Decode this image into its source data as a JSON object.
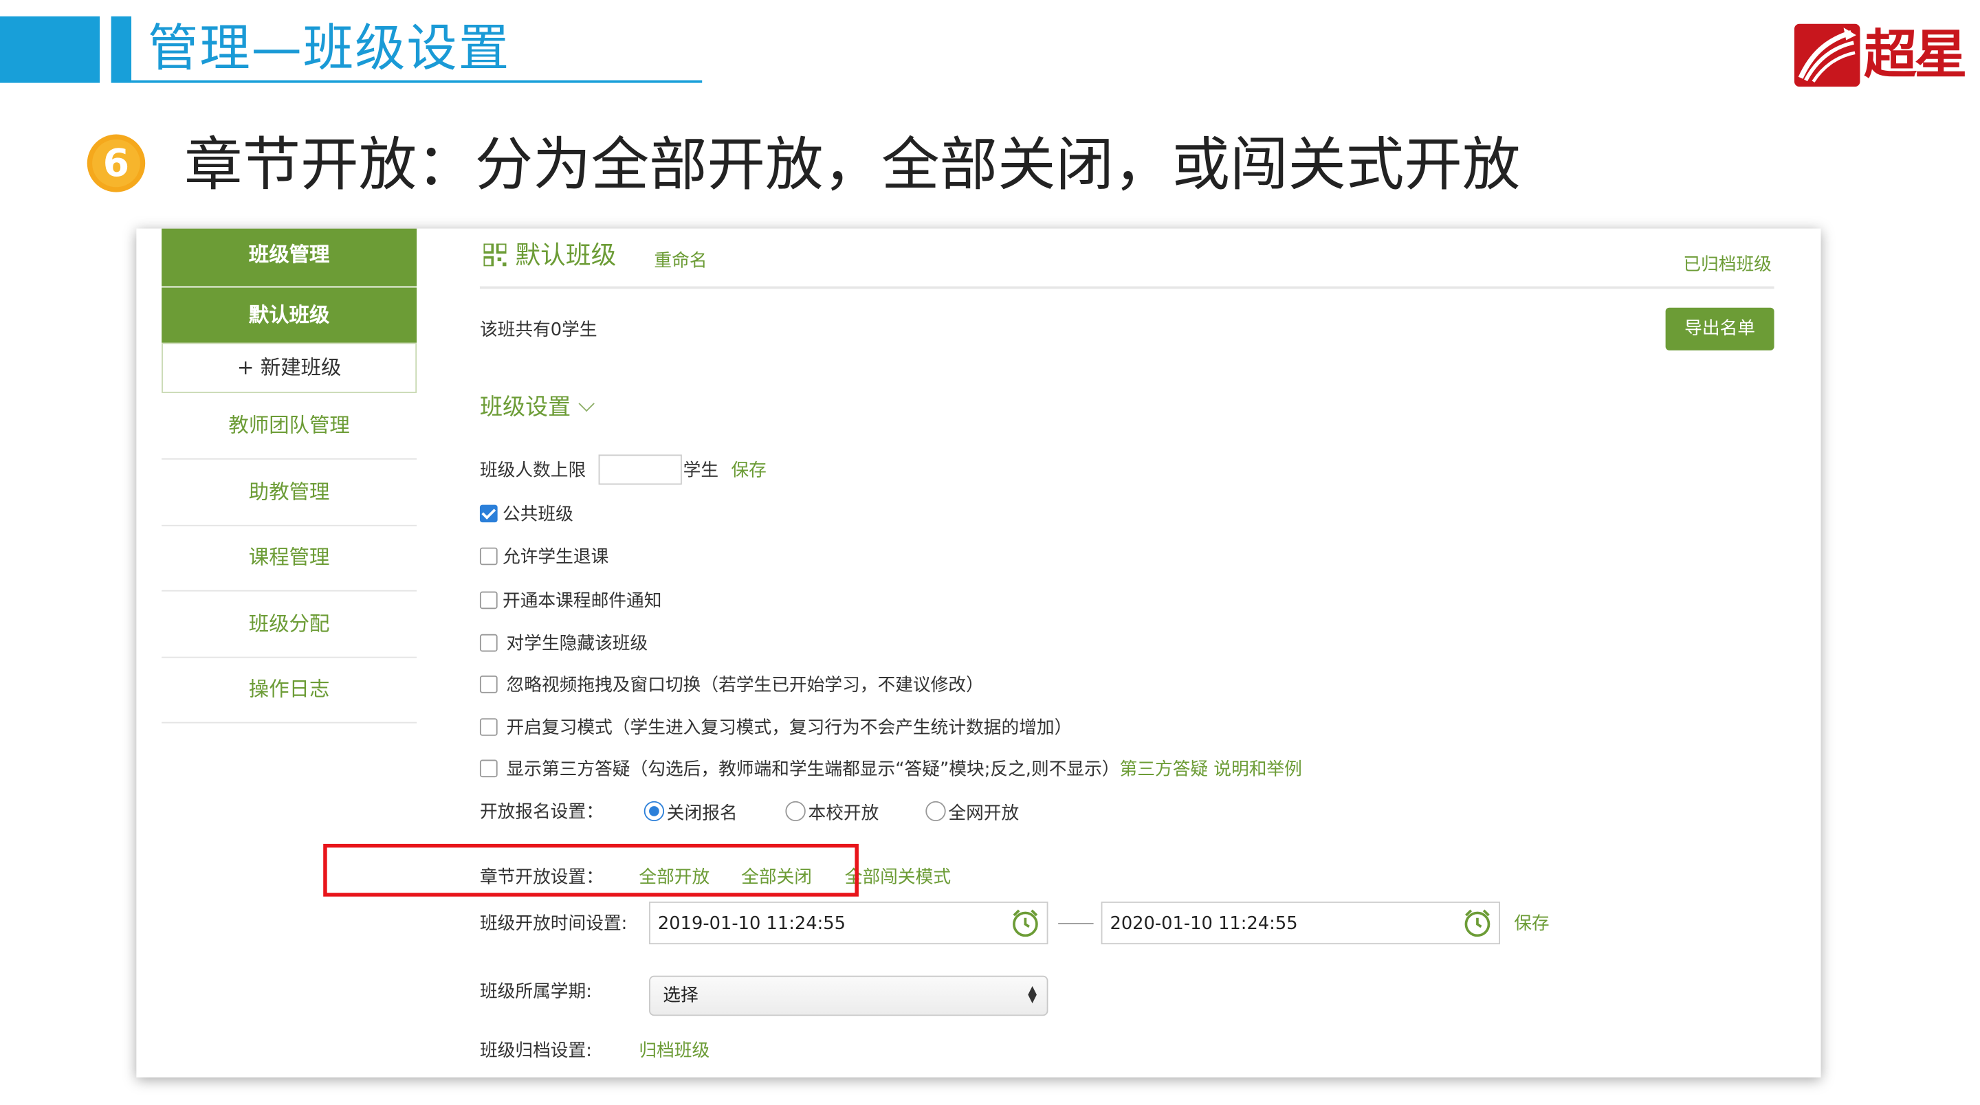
{
  "slide": {
    "title": "管理—班级设置",
    "step_number": "6",
    "subtitle": "章节开放：分为全部开放，全部关闭，或闯关式开放",
    "logo_text": "超星"
  },
  "sidebar": {
    "header": "班级管理",
    "active_class": "默认班级",
    "new_class": "+ 新建班级",
    "items": [
      "教师团队管理",
      "助教管理",
      "课程管理",
      "班级分配",
      "操作日志"
    ]
  },
  "main": {
    "class_name": "默认班级",
    "rename": "重命名",
    "archived_classes": "已归档班级",
    "student_count": "该班共有0学生",
    "export_button": "导出名单",
    "section_title": "班级设置",
    "limit_label": "班级人数上限",
    "limit_value": "",
    "limit_unit": "学生",
    "save": "保存",
    "checkboxes": [
      {
        "label": "公共班级",
        "checked": true
      },
      {
        "label": "允许学生退课",
        "checked": false
      },
      {
        "label": "开通本课程邮件通知",
        "checked": false
      },
      {
        "label": "对学生隐藏该班级",
        "checked": false
      },
      {
        "label": "忽略视频拖拽及窗口切换（若学生已开始学习，不建议修改）",
        "checked": false
      },
      {
        "label": "开启复习模式（学生进入复习模式，复习行为不会产生统计数据的增加）",
        "checked": false
      },
      {
        "label": "显示第三方答疑（勾选后，教师端和学生端都显示“答疑”模块;反之,则不显示）",
        "checked": false,
        "link": "第三方答疑 说明和举例"
      }
    ],
    "enroll": {
      "label": "开放报名设置：",
      "options": [
        "关闭报名",
        "本校开放",
        "全网开放"
      ],
      "selected": "关闭报名"
    },
    "chapter": {
      "label": "章节开放设置：",
      "options": [
        "全部开放",
        "全部关闭",
        "全部闯关模式"
      ]
    },
    "time": {
      "label": "班级开放时间设置:",
      "start": "2019-01-10 11:24:55",
      "end": "2020-01-10 11:24:55",
      "save": "保存"
    },
    "semester": {
      "label": "班级所属学期:",
      "value": "选择"
    },
    "archive": {
      "label": "班级归档设置:",
      "link": "归档班级"
    }
  },
  "colors": {
    "header_blue": "#189fd9",
    "accent_green": "#6c9c36",
    "highlight_red": "#e8151b",
    "badge_orange": "#f5a81c",
    "check_blue": "#2b7fd9"
  }
}
